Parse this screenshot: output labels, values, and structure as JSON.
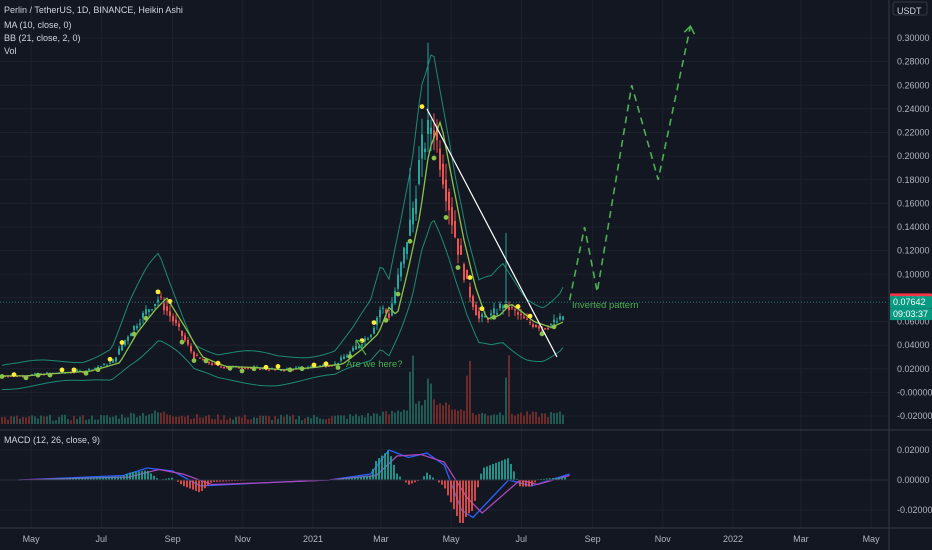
{
  "legend": {
    "symbol": "Perlin / TetherUS, 1D, BINANCE, Heikin Ashi",
    "ma": "MA (10, close, 0)",
    "bb": "BB (21, close, 2, 0)",
    "vol": "Vol",
    "macd": "MACD (12, 26, close, 9)"
  },
  "currency": "USDT",
  "colors": {
    "bg": "#131722",
    "up": "#26a69a",
    "down": "#ef5350",
    "ma": "#8bc34a",
    "bb": "#1e8a74",
    "yellow_dot": "#ffeb3b",
    "green_dot": "#8bc34a",
    "trendline": "#ffffff",
    "projection": "#4caf50",
    "macd": "#2962ff",
    "signal": "#ab47bc",
    "annotation": "#4caf50",
    "badge_red": "#f23645",
    "badge_green": "#089981"
  },
  "price_badges": {
    "close_red": "0.07870",
    "close_green": "0.07642",
    "timer": "09:03:37"
  },
  "annotations": {
    "are_we_here": "Are we here?",
    "inverted": "Inverted pattern"
  },
  "chart_data": [
    {
      "type": "candlestick",
      "title": "Perlin / TetherUS, 1D, BINANCE, Heikin Ashi",
      "ylabel": "USDT",
      "y_ticks": [
        "0.30000",
        "0.28000",
        "0.26000",
        "0.24000",
        "0.22000",
        "0.20000",
        "0.18000",
        "0.16000",
        "0.14000",
        "0.12000",
        "0.10000",
        "0.08000",
        "0.06000",
        "0.04000",
        "0.02000",
        "-0.00000",
        "-0.02000"
      ],
      "x_ticks": [
        "May",
        "Jul",
        "Sep",
        "Nov",
        "2021",
        "Mar",
        "May",
        "Jul",
        "Sep",
        "Nov",
        "2022",
        "Mar",
        "May"
      ],
      "ylim": [
        -0.025,
        0.315
      ],
      "price_path": {
        "x": [
          "2020-04-20",
          "2020-05-15",
          "2020-06-15",
          "2020-07-10",
          "2020-07-25",
          "2020-08-10",
          "2020-08-20",
          "2020-09-05",
          "2020-09-20",
          "2020-10-10",
          "2020-11-05",
          "2020-12-01",
          "2020-12-25",
          "2021-01-20",
          "2021-02-05",
          "2021-02-20",
          "2021-03-01",
          "2021-03-08",
          "2021-03-18",
          "2021-03-28",
          "2021-04-05",
          "2021-04-15",
          "2021-04-25",
          "2021-05-05",
          "2021-05-15",
          "2021-05-25",
          "2021-06-05",
          "2021-06-15",
          "2021-06-25",
          "2021-07-05",
          "2021-07-20",
          "2021-08-05",
          "2021-08-12"
        ],
        "y": [
          0.014,
          0.016,
          0.018,
          0.025,
          0.05,
          0.07,
          0.08,
          0.055,
          0.03,
          0.022,
          0.021,
          0.019,
          0.021,
          0.024,
          0.036,
          0.05,
          0.072,
          0.065,
          0.105,
          0.15,
          0.205,
          0.23,
          0.18,
          0.13,
          0.09,
          0.062,
          0.065,
          0.075,
          0.068,
          0.06,
          0.055,
          0.062,
          0.076
        ]
      },
      "trendline": {
        "x": [
          "2021-04-10",
          "2021-08-01"
        ],
        "y": [
          0.24,
          0.03
        ]
      },
      "projection": {
        "x": [
          "2021-08-12",
          "2021-08-25",
          "2021-09-05",
          "2021-10-05",
          "2021-10-28",
          "2021-11-25"
        ],
        "y": [
          0.078,
          0.14,
          0.085,
          0.26,
          0.18,
          0.31
        ]
      },
      "volume_spikes": [
        "2021-03-28",
        "2021-04-12",
        "2021-05-15",
        "2021-06-18"
      ]
    },
    {
      "type": "line",
      "title": "MACD (12, 26, close, 9)",
      "y_ticks": [
        "0.02000",
        "0.00000",
        "-0.02000"
      ],
      "ylim": [
        -0.027,
        0.03
      ],
      "series": [
        {
          "x": [
            "2020-04-20",
            "2020-07-20",
            "2020-08-10",
            "2020-09-01",
            "2020-09-25",
            "2020-11-15",
            "2021-01-15",
            "2021-02-20",
            "2021-03-08",
            "2021-03-25",
            "2021-04-10",
            "2021-04-25",
            "2021-05-10",
            "2021-05-20",
            "2021-06-05",
            "2021-06-20",
            "2021-07-10",
            "2021-08-12"
          ],
          "y": [
            0.0,
            0.003,
            0.008,
            0.006,
            -0.004,
            -0.002,
            0.0,
            0.004,
            0.02,
            0.015,
            0.018,
            0.01,
            -0.02,
            -0.025,
            -0.012,
            0.0,
            -0.004,
            0.004
          ]
        },
        {
          "x": [
            "2020-04-20",
            "2020-07-25",
            "2020-08-20",
            "2020-09-10",
            "2020-10-05",
            "2020-11-15",
            "2021-01-15",
            "2021-02-25",
            "2021-03-15",
            "2021-04-05",
            "2021-04-25",
            "2021-05-15",
            "2021-05-28",
            "2021-06-15",
            "2021-06-30",
            "2021-07-15",
            "2021-08-12"
          ],
          "y": [
            0.0,
            0.002,
            0.007,
            0.004,
            -0.003,
            -0.002,
            0.0,
            0.003,
            0.016,
            0.017,
            0.012,
            -0.012,
            -0.022,
            -0.01,
            0.0,
            -0.003,
            0.003
          ]
        }
      ]
    }
  ]
}
